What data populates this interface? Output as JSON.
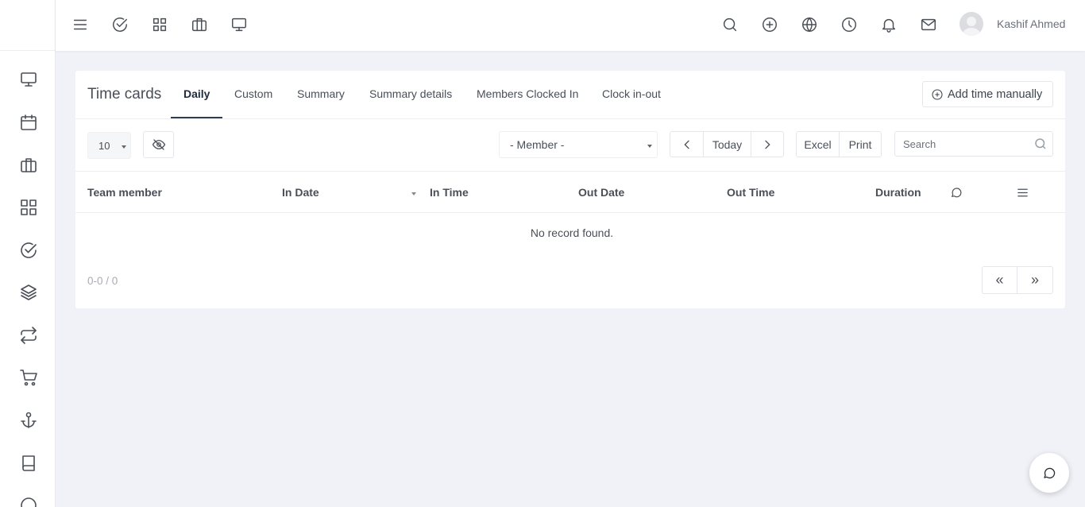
{
  "topbar": {
    "left_icons": [
      "menu-icon",
      "check-circle-icon",
      "grid-icon",
      "briefcase-icon",
      "monitor-icon"
    ],
    "right_icons": [
      "search-icon",
      "plus-circle-icon",
      "globe-icon",
      "clock-icon",
      "bell-icon",
      "mail-icon"
    ],
    "user_name": "Kashif Ahmed"
  },
  "sidebar": {
    "items": [
      "monitor-icon",
      "calendar-icon",
      "briefcase-icon",
      "grid-icon",
      "check-circle-icon",
      "layers-icon",
      "repeat-icon",
      "cart-icon",
      "anchor-icon",
      "book-icon",
      "help-circle-icon"
    ]
  },
  "card": {
    "title": "Time cards",
    "tabs": [
      {
        "label": "Daily",
        "active": true
      },
      {
        "label": "Custom"
      },
      {
        "label": "Summary"
      },
      {
        "label": "Summary details"
      },
      {
        "label": "Members Clocked In"
      },
      {
        "label": "Clock in-out"
      }
    ],
    "add_button": "Add time manually"
  },
  "toolbar": {
    "page_size": "10",
    "member_placeholder": "- Member -",
    "today": "Today",
    "excel": "Excel",
    "print": "Print",
    "search_placeholder": "Search"
  },
  "table": {
    "columns": [
      "Team member",
      "In Date",
      "In Time",
      "Out Date",
      "Out Time",
      "Duration"
    ],
    "empty_message": "No record found.",
    "pagination_info": "0-0 / 0",
    "first_page": "«",
    "last_page": "»"
  }
}
